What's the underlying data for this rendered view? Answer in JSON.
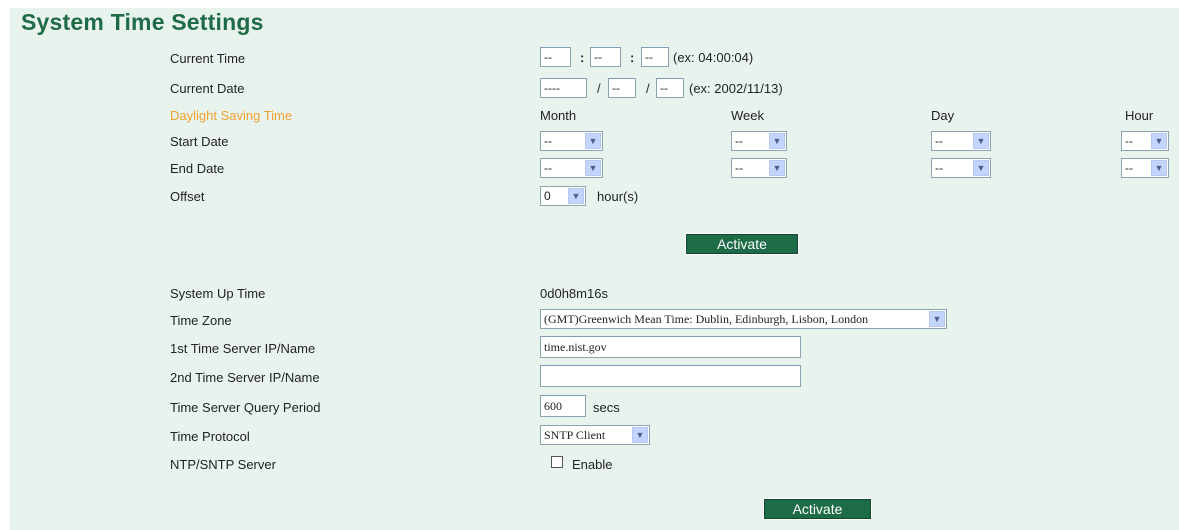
{
  "page": {
    "title": "System Time Settings"
  },
  "current_time": {
    "label": "Current Time",
    "hour": "--",
    "minute": "--",
    "second": "--",
    "sep": ":",
    "example": "(ex: 04:00:04)"
  },
  "current_date": {
    "label": "Current Date",
    "year": "----",
    "month": "--",
    "day": "--",
    "sep": "/",
    "example": "(ex: 2002/11/13)"
  },
  "dst": {
    "label": "Daylight Saving Time",
    "columns": [
      "Month",
      "Week",
      "Day",
      "Hour"
    ],
    "start": {
      "label": "Start Date",
      "month": "--",
      "week": "--",
      "day": "--",
      "hour": "--"
    },
    "end": {
      "label": "End Date",
      "month": "--",
      "week": "--",
      "day": "--",
      "hour": "--"
    },
    "offset": {
      "label": "Offset",
      "value": "0",
      "unit": "hour(s)"
    }
  },
  "activate_label_1": "Activate",
  "system_up_time": {
    "label": "System Up Time",
    "value": "0d0h8m16s"
  },
  "time_zone": {
    "label": "Time Zone",
    "value": "(GMT)Greenwich Mean Time: Dublin, Edinburgh, Lisbon, London"
  },
  "time_server_1": {
    "label": "1st Time Server IP/Name",
    "value": "time.nist.gov"
  },
  "time_server_2": {
    "label": "2nd Time Server IP/Name",
    "value": ""
  },
  "query_period": {
    "label": "Time Server Query Period",
    "value": "600",
    "unit": "secs"
  },
  "time_protocol": {
    "label": "Time Protocol",
    "value": "SNTP Client"
  },
  "ntp_server": {
    "label": "NTP/SNTP Server",
    "enable_label": "Enable",
    "checked": false
  },
  "activate_label_2": "Activate",
  "colors": {
    "title": "#1f6b46",
    "panel_bg": "#e9f3ee",
    "dst_header": "#f0a030",
    "button_bg": "#1e6b47"
  }
}
